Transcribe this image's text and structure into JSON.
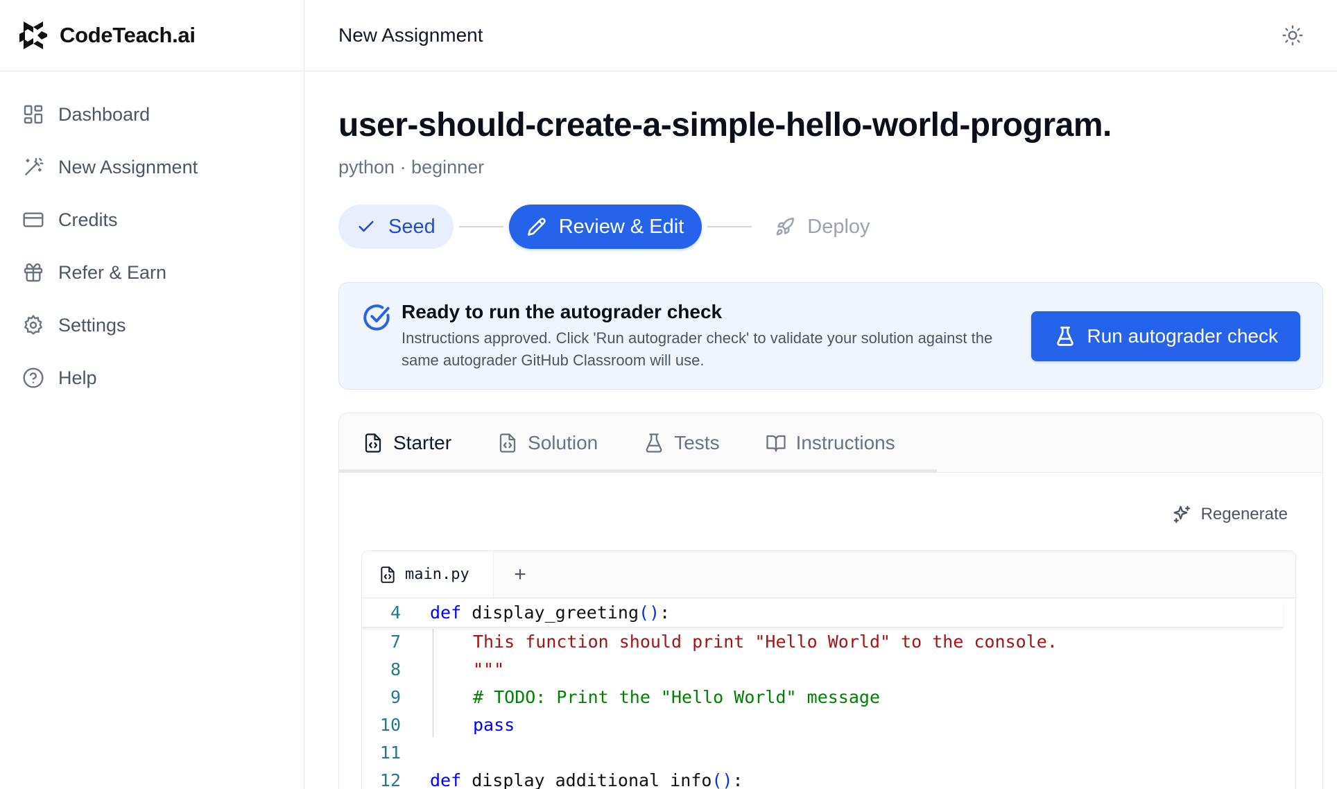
{
  "brand": {
    "name": "CodeTeach.ai"
  },
  "sidebar": {
    "items": [
      {
        "label": "Dashboard",
        "icon": "dashboard-icon"
      },
      {
        "label": "New Assignment",
        "icon": "magic-wand-icon"
      },
      {
        "label": "Credits",
        "icon": "credit-card-icon"
      },
      {
        "label": "Refer & Earn",
        "icon": "gift-icon"
      },
      {
        "label": "Settings",
        "icon": "gear-icon"
      },
      {
        "label": "Help",
        "icon": "help-circle-icon"
      }
    ]
  },
  "header": {
    "title": "New Assignment",
    "theme_icon": "sun-icon"
  },
  "page": {
    "title": "user-should-create-a-simple-hello-world-program.",
    "subtitle": "python · beginner"
  },
  "stepper": {
    "steps": [
      {
        "label": "Seed",
        "state": "done"
      },
      {
        "label": "Review & Edit",
        "state": "active"
      },
      {
        "label": "Deploy",
        "state": "pending"
      }
    ]
  },
  "notice": {
    "title": "Ready to run the autograder check",
    "description": "Instructions approved. Click 'Run autograder check' to validate your solution against the same autograder GitHub Classroom will use.",
    "button_label": "Run autograder check"
  },
  "tabs": {
    "items": [
      {
        "label": "Starter",
        "active": true
      },
      {
        "label": "Solution",
        "active": false
      },
      {
        "label": "Tests",
        "active": false
      },
      {
        "label": "Instructions",
        "active": false
      }
    ]
  },
  "panel": {
    "regenerate_label": "Regenerate"
  },
  "editor": {
    "file_tab": "main.py",
    "add_label": "+",
    "lines": [
      {
        "n": "4",
        "kw": "def",
        "name": " display_greeting",
        "paren": "()",
        "tail": ":"
      },
      {
        "n": "7",
        "text": "This function should print \"Hello World\" to the console."
      },
      {
        "n": "8",
        "text": "\"\"\""
      },
      {
        "n": "9",
        "text": "# TODO: Print the \"Hello World\" message"
      },
      {
        "n": "10",
        "text": "pass"
      },
      {
        "n": "11",
        "text": ""
      },
      {
        "n": "12",
        "kw": "def",
        "name": " display_additional_info",
        "paren": "()",
        "tail": ":"
      }
    ]
  },
  "colors": {
    "accent": "#2563eb",
    "accent_soft": "#e8eefc",
    "notice_bg": "#f1f5fe",
    "code_keyword": "#0000ff",
    "code_string": "#a31515",
    "code_comment": "#008000",
    "line_number": "#237893"
  }
}
